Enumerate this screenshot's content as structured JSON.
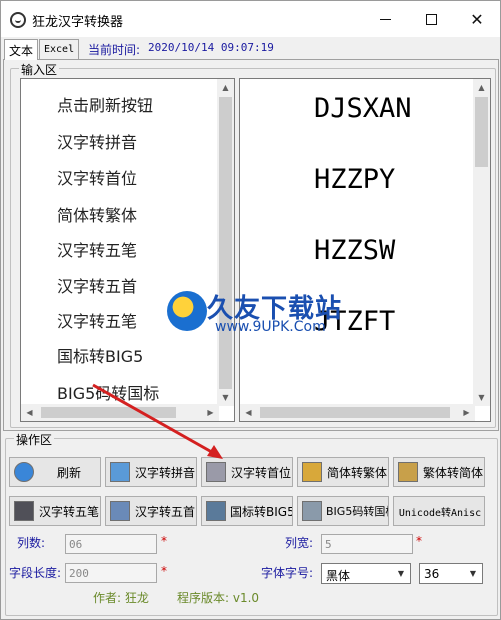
{
  "window": {
    "title": "狂龙汉字转换器"
  },
  "tabs": [
    {
      "label": "文本"
    },
    {
      "label": "Excel"
    }
  ],
  "status": {
    "time_label": "当前时间:",
    "time_value": "2020/10/14  09:07:19"
  },
  "input_area": {
    "label": "输入区",
    "left_list": [
      "点击刷新按钮",
      "汉字转拼音",
      "汉字转首位",
      "简体转繁体",
      "汉字转五笔",
      "汉字转五首",
      "汉字转五笔",
      "国标转BIG5",
      "BIG5码转国标"
    ],
    "right_list": [
      "DJSXAN",
      "HZZPY",
      "HZZSW",
      "JTZFT"
    ]
  },
  "operation_area": {
    "label": "操作区",
    "row1": [
      "刷新",
      "汉字转拼音",
      "汉字转首位",
      "简体转繁体",
      "繁体转简体"
    ],
    "row2": [
      "汉字转五笔",
      "汉字转五首",
      "国标转BIG5",
      "BIG5码转国标",
      "Unicode转Anisc"
    ],
    "columns_label": "列数:",
    "columns_value": "06",
    "col_width_label": "列宽:",
    "col_width_value": "5",
    "field_length_label": "字段长度:",
    "field_length_value": "200",
    "font_label": "字体字号:",
    "font_value": "黑体",
    "font_size_value": "36",
    "required_mark": "*"
  },
  "footer": {
    "author": "作者: 狂龙",
    "version": "程序版本: v1.0"
  },
  "watermark": {
    "text": "久友下载站",
    "url": "www.9UPK.Com"
  },
  "colors": {
    "label_blue": "#1a1aa0",
    "required_red": "#cc0000",
    "footer_green": "#6a8a2a",
    "arrow_red": "#d42020"
  }
}
